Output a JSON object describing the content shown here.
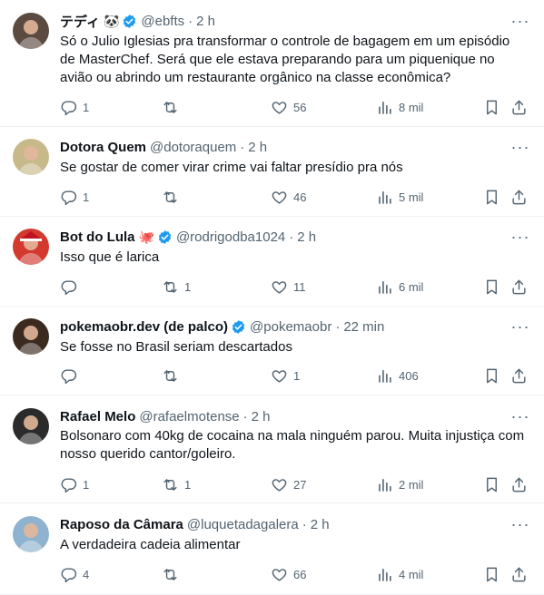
{
  "tweets": [
    {
      "name": "テディ",
      "emoji": "🐼",
      "verified": true,
      "handle": "@ebfts",
      "time": "2 h",
      "text": "Só o Julio Iglesias pra transformar o controle de bagagem em um episódio de MasterChef. Será que ele estava preparando para um piquenique no avião ou abrindo um restaurante orgânico na classe econômica?",
      "replies": "1",
      "retweets": "",
      "likes": "56",
      "views": "8 mil",
      "avatar_color": "#5b4a3f"
    },
    {
      "name": "Dotora Quem",
      "emoji": "",
      "verified": false,
      "handle": "@dotoraquem",
      "time": "2 h",
      "text": "Se gostar de comer virar crime vai faltar presídio pra nós",
      "replies": "1",
      "retweets": "",
      "likes": "46",
      "views": "5 mil",
      "avatar_color": "#c8b98a"
    },
    {
      "name": "Bot do Lula",
      "emoji": "🐙",
      "verified": true,
      "handle": "@rodrigodba1024",
      "time": "2 h",
      "text": "Isso que é larica",
      "replies": "",
      "retweets": "1",
      "likes": "11",
      "views": "6 mil",
      "avatar_color": "#d23a2f"
    },
    {
      "name": "pokemaobr.dev (de palco)",
      "emoji": "",
      "verified": true,
      "handle": "@pokemaobr",
      "time": "22 min",
      "text": "Se fosse no Brasil seriam descartados",
      "replies": "",
      "retweets": "",
      "likes": "1",
      "views": "406",
      "avatar_color": "#3a2a20"
    },
    {
      "name": "Rafael Melo",
      "emoji": "",
      "verified": false,
      "handle": "@rafaelmotense",
      "time": "2 h",
      "text": "Bolsonaro com 40kg de cocaina na mala ninguém parou. Muita injustiça com nosso querido cantor/goleiro.",
      "replies": "1",
      "retweets": "1",
      "likes": "27",
      "views": "2 mil",
      "avatar_color": "#2b2b2b"
    },
    {
      "name": "Raposo da Câmara",
      "emoji": "",
      "verified": false,
      "handle": "@luquetadagalera",
      "time": "2 h",
      "text": "A verdadeira cadeia alimentar",
      "replies": "4",
      "retweets": "",
      "likes": "66",
      "views": "4 mil",
      "avatar_color": "#8fb3cf"
    }
  ],
  "colors": {
    "text": "#0f1419",
    "secondary": "#536471",
    "verified": "#1d9bf0",
    "divider": "#eff3f4"
  },
  "icons": {
    "reply": "reply-icon",
    "retweet": "retweet-icon",
    "like": "heart-icon",
    "views": "views-icon",
    "bookmark": "bookmark-icon",
    "share": "share-icon",
    "more": "more-icon",
    "verified": "verified-badge-icon"
  }
}
